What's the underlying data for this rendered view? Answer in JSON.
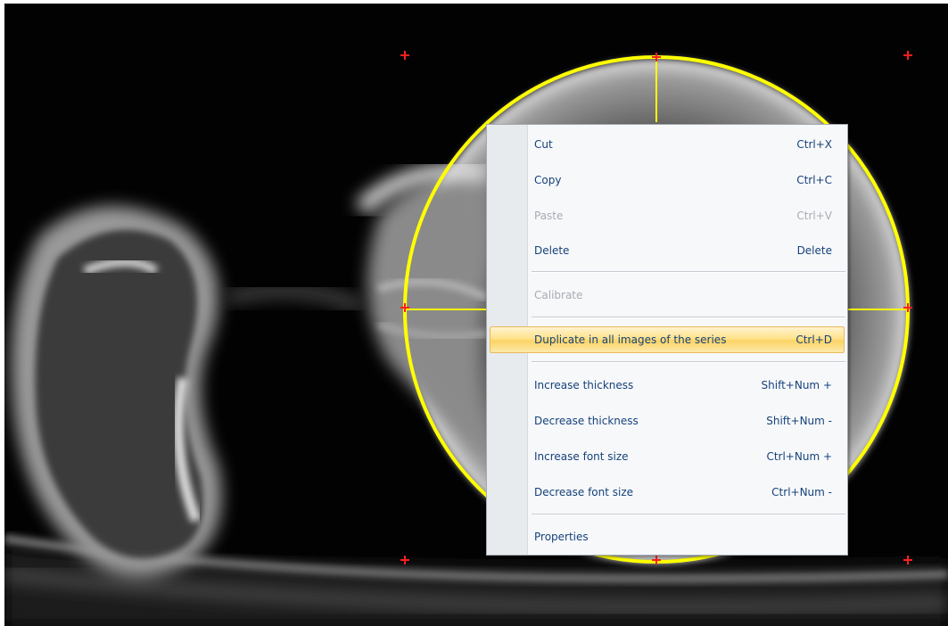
{
  "viewer": {
    "annotation_color": "#ffff00",
    "marker_color": "#ff1e1e",
    "background": "#020202"
  },
  "context_menu": {
    "items": [
      {
        "label": "Cut",
        "shortcut": "Ctrl+X",
        "enabled": true
      },
      {
        "label": "Copy",
        "shortcut": "Ctrl+C",
        "enabled": true
      },
      {
        "label": "Paste",
        "shortcut": "Ctrl+V",
        "enabled": false
      },
      {
        "label": "Delete",
        "shortcut": "Delete",
        "enabled": true
      },
      {
        "label": "Calibrate",
        "shortcut": "",
        "enabled": false
      },
      {
        "label": "Duplicate in all images of the series",
        "shortcut": "Ctrl+D",
        "enabled": true,
        "highlighted": true
      },
      {
        "label": "Increase thickness",
        "shortcut": "Shift+Num +",
        "enabled": true
      },
      {
        "label": "Decrease thickness",
        "shortcut": "Shift+Num -",
        "enabled": true
      },
      {
        "label": "Increase font size",
        "shortcut": "Ctrl+Num +",
        "enabled": true
      },
      {
        "label": "Decrease font size",
        "shortcut": "Ctrl+Num -",
        "enabled": true
      },
      {
        "label": "Properties",
        "shortcut": "",
        "enabled": true
      }
    ]
  }
}
